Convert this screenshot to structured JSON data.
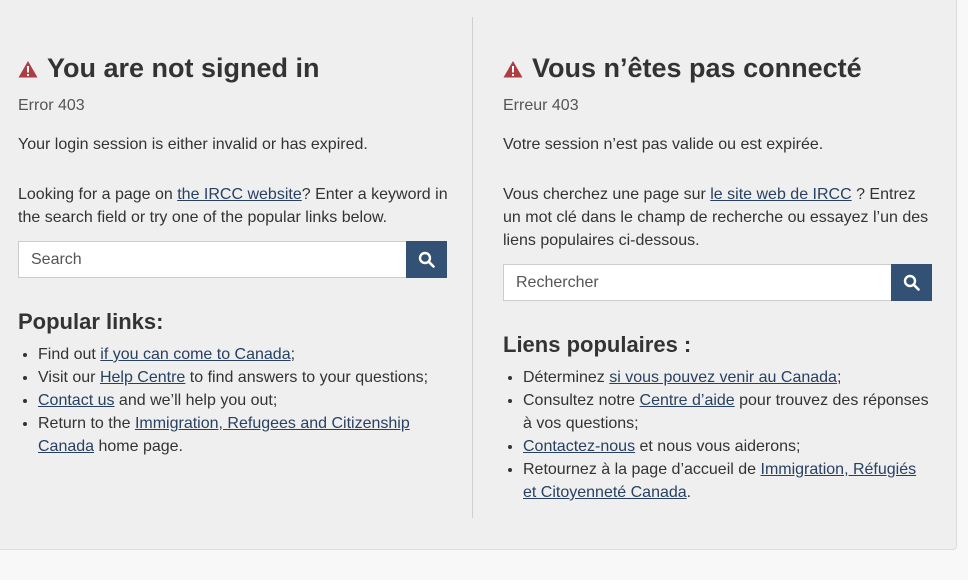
{
  "en": {
    "title": "You are not signed in",
    "error_code": "Error 403",
    "session_text": "Your login session is either invalid or has expired.",
    "looking_before": "Looking for a page on ",
    "looking_link": "the IRCC website",
    "looking_after": "? Enter a keyword in the search field or try one of the popular links below.",
    "search_placeholder": "Search",
    "popular_heading": "Popular links:",
    "links": [
      {
        "before": "Find out ",
        "link": "if you can come to Canada",
        "after": ";"
      },
      {
        "before": "Visit our ",
        "link": "Help Centre",
        "after": " to find answers to your questions;"
      },
      {
        "before": "",
        "link": "Contact us",
        "after": " and we’ll help you out;"
      },
      {
        "before": "Return to the ",
        "link": "Immigration, Refugees and Citizenship Canada",
        "after": " home page."
      }
    ]
  },
  "fr": {
    "title": "Vous n’êtes pas connecté",
    "error_code": "Erreur 403",
    "session_text": "Votre session n’est pas valide ou est expirée.",
    "looking_before": "Vous cherchez une page sur ",
    "looking_link": "le site web de IRCC",
    "looking_after": " ? Entrez un mot clé dans le champ de recherche ou essayez l’un des liens populaires ci-dessous.",
    "search_placeholder": "Rechercher",
    "popular_heading": "Liens populaires :",
    "links": [
      {
        "before": "Déterminez ",
        "link": "si vous pouvez venir au Canada",
        "after": ";"
      },
      {
        "before": "Consultez notre ",
        "link": "Centre d’aide",
        "after": " pour trouvez des réponses à vos questions;"
      },
      {
        "before": "",
        "link": "Contactez-nous",
        "after": " et nous vous aiderons;"
      },
      {
        "before": "Retournez à la page d’accueil de ",
        "link": "Immigration, Réfugiés et Citoyenneté Canada",
        "after": "."
      }
    ]
  },
  "icons": {
    "warning": "warning-icon",
    "search": "search-icon"
  },
  "colors": {
    "warning": "#af3c43",
    "link": "#284162",
    "search_button": "#335075",
    "panel_bg": "#efefef"
  }
}
